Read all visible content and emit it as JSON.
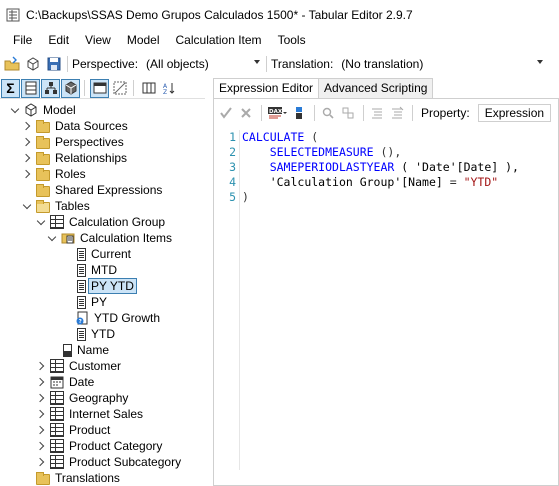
{
  "window": {
    "title": "C:\\Backups\\SSAS Demo Grupos Calculados 1500* - Tabular Editor 2.9.7"
  },
  "menu": [
    "File",
    "Edit",
    "View",
    "Model",
    "Calculation Item",
    "Tools"
  ],
  "toolbar": {
    "perspective_label": "Perspective:",
    "perspective_value": "(All objects)",
    "translation_label": "Translation:",
    "translation_value": "(No translation)"
  },
  "tree": {
    "model": "Model",
    "data_sources": "Data Sources",
    "perspectives": "Perspectives",
    "relationships": "Relationships",
    "roles": "Roles",
    "shared_expressions": "Shared Expressions",
    "tables": "Tables",
    "calc_group": "Calculation Group",
    "calc_items": "Calculation Items",
    "items": [
      "Current",
      "MTD",
      "PY YTD",
      "PY",
      "YTD Growth",
      "YTD"
    ],
    "name_col": "Name",
    "other_tables": [
      "Customer",
      "Date",
      "Geography",
      "Internet Sales",
      "Product",
      "Product Category",
      "Product Subcategory"
    ],
    "translations": "Translations"
  },
  "tabs": [
    "Expression Editor",
    "Advanced Scripting"
  ],
  "property": {
    "label": "Property:",
    "value": "Expression"
  },
  "code": {
    "line_numbers": [
      "1",
      "2",
      "3",
      "4",
      "5"
    ],
    "l1_kw": "CALCULATE",
    "l1_rest": " (",
    "l2_indent": "    ",
    "l2_fn": "SELECTEDMEASURE",
    "l2_rest": " (),",
    "l3_indent": "    ",
    "l3_fn": "SAMEPERIODLASTYEAR",
    "l3_rest": " ( 'Date'[Date] ),",
    "l4_indent": "    ",
    "l4_ref": "'Calculation Group'[Name]",
    "l4_eq": " = ",
    "l4_str": "\"YTD\"",
    "l5": ")"
  },
  "colors": {
    "accent": "#3c7fb1",
    "selection": "#cce4f7",
    "keyword": "#0000ff",
    "string": "#a31515"
  }
}
